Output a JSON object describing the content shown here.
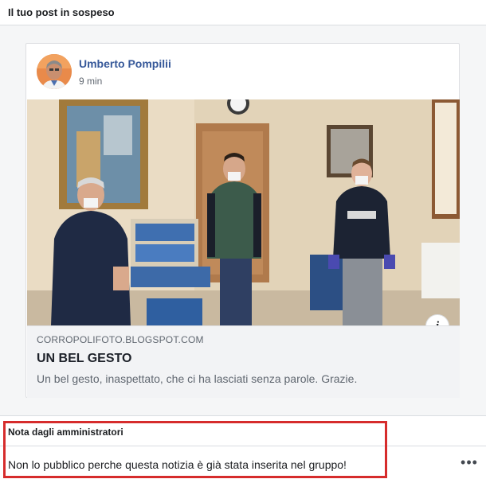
{
  "header": {
    "title": "Il tuo post in sospeso"
  },
  "post": {
    "author_name": "Umberto Pompilii",
    "timestamp": "9 min",
    "avatar_icon": "profile-photo",
    "photo_icon": "people-in-room-photo",
    "info_icon": "info-icon",
    "link": {
      "domain": "CORROPOLIFOTO.BLOGSPOT.COM",
      "title": "UN BEL GESTO",
      "description": "Un bel gesto, inaspettato, che ci ha lasciati senza parole. Grazie."
    }
  },
  "admin_note": {
    "title": "Nota dagli amministratori",
    "text": "Non lo pubblico perche questa notizia è già stata inserita nel gruppo!",
    "more_label": "•••"
  },
  "colors": {
    "author_link": "#365899",
    "highlight": "#d62c2c",
    "panel_bg": "#f5f6f7"
  }
}
